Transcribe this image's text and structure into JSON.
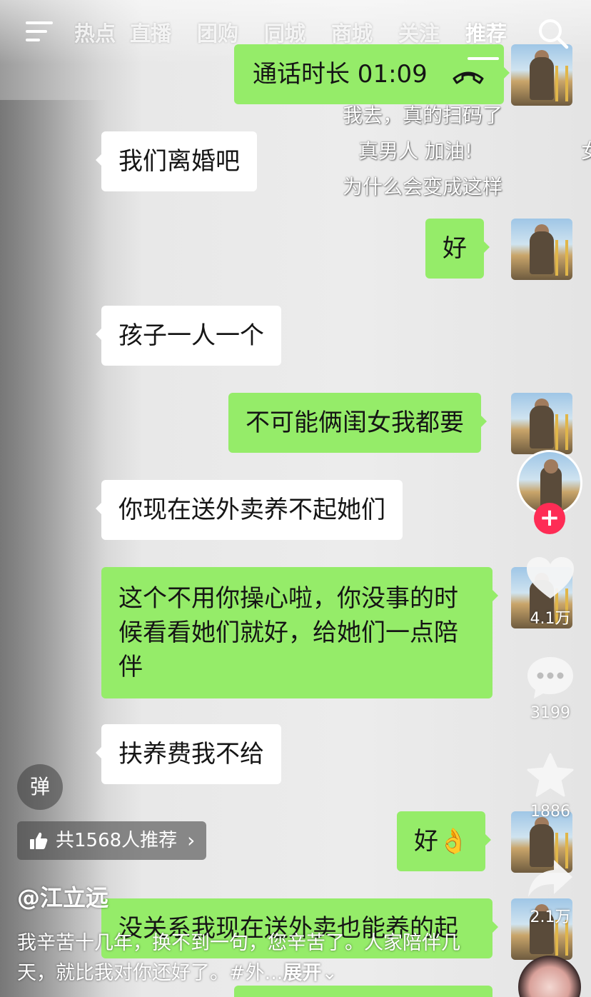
{
  "topnav": {
    "tabs": [
      "热点",
      "直播",
      "团购",
      "同城",
      "商城",
      "关注",
      "推荐"
    ],
    "active_tab": "推荐"
  },
  "chat": {
    "call": {
      "label": "通话时长 01:09"
    },
    "messages": [
      {
        "side": "in",
        "text": "我们离婚吧"
      },
      {
        "side": "out",
        "text": "好"
      },
      {
        "side": "in",
        "text": "孩子一人一个"
      },
      {
        "side": "out",
        "text": "不可能俩闺女我都要"
      },
      {
        "side": "in",
        "text": "你现在送外卖养不起她们"
      },
      {
        "side": "out",
        "text": "这个不用你操心啦，你没事的时候看看她们就好，给她们一点陪伴"
      },
      {
        "side": "in",
        "text": "扶养费我不给"
      },
      {
        "side": "out",
        "text": "好👌"
      },
      {
        "side": "out",
        "text": "没关系我现在送外卖也能养的起"
      }
    ]
  },
  "danmaku": [
    "我去，真的扫码了",
    "真男人 加油!",
    "为什么会变成这样",
    "女"
  ],
  "rail": {
    "likes": "4.1万",
    "comments": "3199",
    "favorites": "1886",
    "shares": "2.1万",
    "follow_symbol": "+"
  },
  "bottom": {
    "danmu_toggle": "弹",
    "recommend": "共1568人推荐",
    "author": "@江立远",
    "caption": "我辛苦十几年，换不到一句，您辛苦了。人家陪伴几天，就比我对你还好了。#外...",
    "expand": "展开"
  },
  "colors": {
    "bubble_out": "#95ec69",
    "bubble_in": "#ffffff",
    "follow": "#fe2c55"
  }
}
